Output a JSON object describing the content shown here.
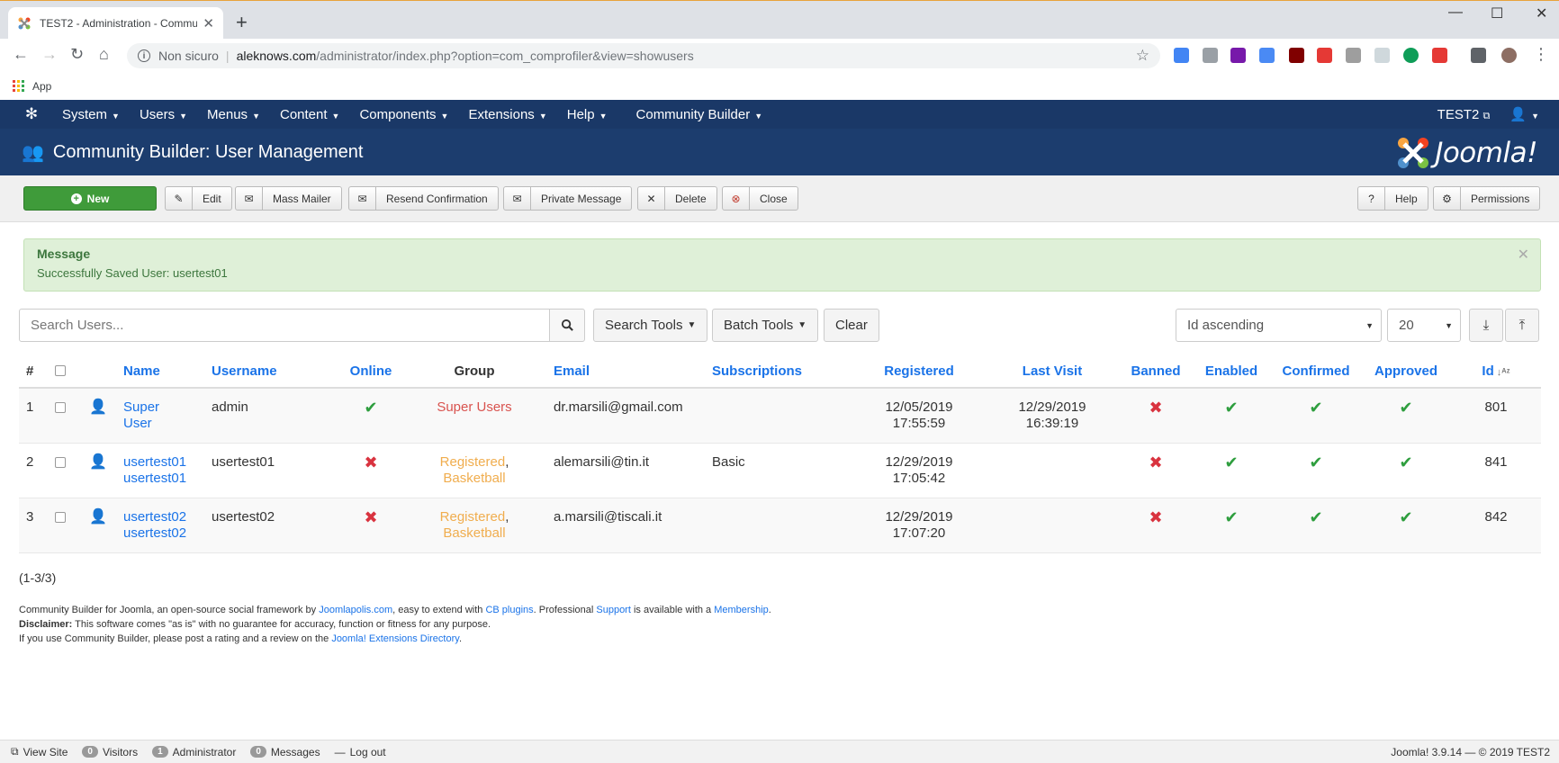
{
  "browser": {
    "tab_title": "TEST2 - Administration - Commu",
    "omnibox_security": "Non sicuro",
    "omnibox_host": "aleknows.com",
    "omnibox_path": "/administrator/index.php?option=com_comprofiler&view=showusers",
    "bookmark_apps": "App"
  },
  "topnav": {
    "items": [
      "System",
      "Users",
      "Menus",
      "Content",
      "Components",
      "Extensions",
      "Help",
      "Community Builder"
    ],
    "site_link": "TEST2"
  },
  "header": {
    "title": "Community Builder: User Management",
    "brand": "Joomla!"
  },
  "toolbar": {
    "new": "New",
    "edit": "Edit",
    "mass_mailer": "Mass Mailer",
    "resend_confirmation": "Resend Confirmation",
    "private_message": "Private Message",
    "delete": "Delete",
    "close": "Close",
    "help": "Help",
    "permissions": "Permissions"
  },
  "message": {
    "heading": "Message",
    "body": "Successfully Saved User: usertest01"
  },
  "filters": {
    "search_placeholder": "Search Users...",
    "search_tools": "Search Tools",
    "batch_tools": "Batch Tools",
    "clear": "Clear",
    "ordering": "Id ascending",
    "limit": "20"
  },
  "table": {
    "headers": {
      "num": "#",
      "name": "Name",
      "username": "Username",
      "online": "Online",
      "group": "Group",
      "email": "Email",
      "subscriptions": "Subscriptions",
      "registered": "Registered",
      "last_visit": "Last Visit",
      "banned": "Banned",
      "enabled": "Enabled",
      "confirmed": "Confirmed",
      "approved": "Approved",
      "id": "Id"
    },
    "rows": [
      {
        "num": "1",
        "name_1": "Super",
        "name_2": "User",
        "username": "admin",
        "online": true,
        "group_1": "Super Users",
        "group_2": "",
        "email": "dr.marsili@gmail.com",
        "subscriptions": "",
        "reg_date": "12/05/2019",
        "reg_time": "17:55:59",
        "lv_date": "12/29/2019",
        "lv_time": "16:39:19",
        "id": "801"
      },
      {
        "num": "2",
        "name_1": "usertest01",
        "name_2": "usertest01",
        "username": "usertest01",
        "online": false,
        "group_1": "Registered",
        "group_2": "Basketball",
        "email": "alemarsili@tin.it",
        "subscriptions": "Basic",
        "reg_date": "12/29/2019",
        "reg_time": "17:05:42",
        "lv_date": "",
        "lv_time": "",
        "id": "841"
      },
      {
        "num": "3",
        "name_1": "usertest02",
        "name_2": "usertest02",
        "username": "usertest02",
        "online": false,
        "group_1": "Registered",
        "group_2": "Basketball",
        "email": "a.marsili@tiscali.it",
        "subscriptions": "",
        "reg_date": "12/29/2019",
        "reg_time": "17:07:20",
        "lv_date": "",
        "lv_time": "",
        "id": "842"
      }
    ]
  },
  "pagination": "(1-3/3)",
  "footer": {
    "line1_a": "Community Builder for Joomla, an open-source social framework by ",
    "link_joomlapolis": "Joomlapolis.com",
    "line1_b": ", easy to extend with ",
    "link_cbplugins": "CB plugins",
    "line1_c": ". Professional ",
    "link_support": "Support",
    "line1_d": " is available with a ",
    "link_membership": "Membership",
    "line1_e": ".",
    "disclaimer_label": "Disclaimer:",
    "disclaimer_text": " This software comes \"as is\" with no guarantee for accuracy, function or fitness for any purpose.",
    "line3_a": "If you use Community Builder, please post a rating and a review on the ",
    "link_jed": "Joomla! Extensions Directory",
    "line3_b": "."
  },
  "statusbar": {
    "view_site": "View Site",
    "visitors_count": "0",
    "visitors": "Visitors",
    "admin_count": "1",
    "administrator": "Administrator",
    "messages_count": "0",
    "messages": "Messages",
    "logout": "Log out",
    "version": "Joomla! 3.9.14 — © 2019 TEST2"
  },
  "colors": {
    "nav_bg": "#1a3867",
    "header_bg": "#1c3d6e",
    "new_button": "#3f9b3a",
    "link": "#1a73e8",
    "success_bg": "#dff0d8"
  }
}
